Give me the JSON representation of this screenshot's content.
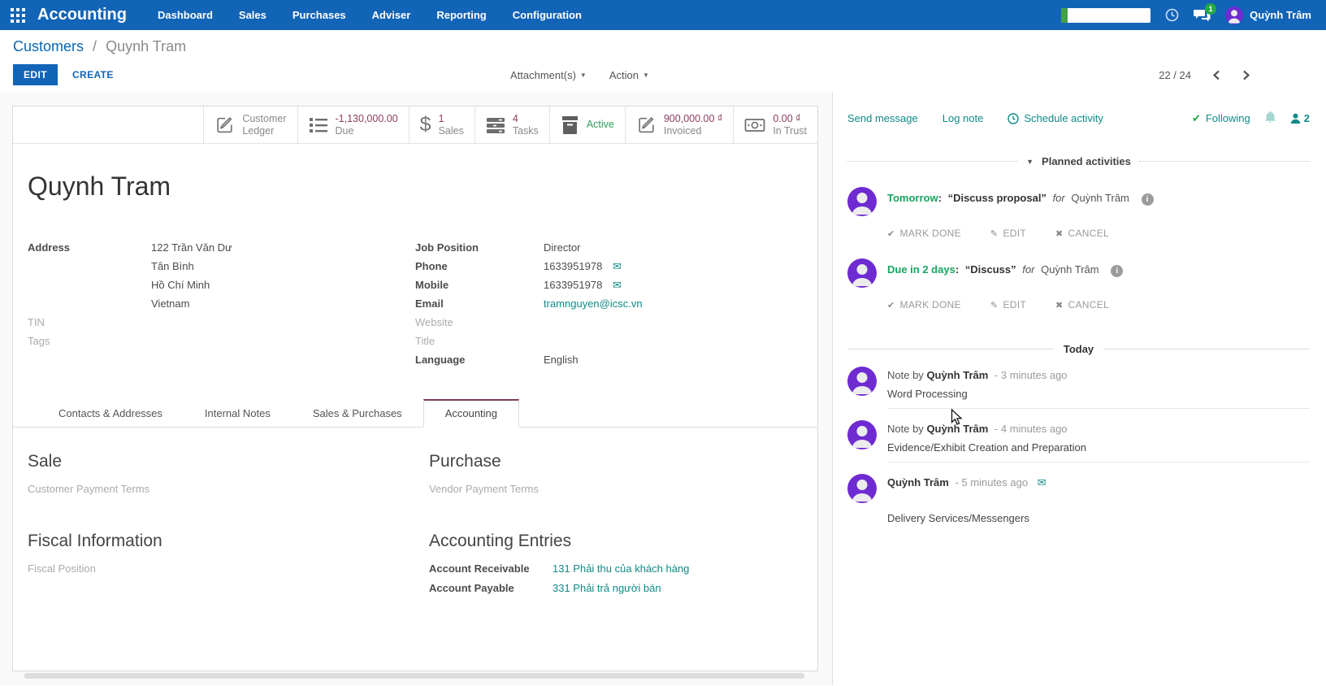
{
  "colors": {
    "navbar_blue": "#1264b7",
    "breadcrumb_link_blue": "#0c66ad",
    "teal_link": "#0f8a87",
    "stat_value_maroon": "#8b3d60",
    "active_green": "#2e9e5b",
    "due_green": "#18a45f",
    "avatar_purple": "#6f2bd2",
    "badge_green": "#28a745"
  },
  "navbar": {
    "app_name": "Accounting",
    "menu": [
      {
        "label": "Dashboard"
      },
      {
        "label": "Sales"
      },
      {
        "label": "Purchases"
      },
      {
        "label": "Adviser"
      },
      {
        "label": "Reporting"
      },
      {
        "label": "Configuration"
      }
    ],
    "messages_badge": "1",
    "user_name": "Quỳnh Trâm"
  },
  "control_panel": {
    "breadcrumb_parent": "Customers",
    "breadcrumb_separator": "/",
    "breadcrumb_current": "Quynh Tram",
    "edit_button": "EDIT",
    "create_button": "CREATE",
    "attachments_dropdown": "Attachment(s)",
    "action_dropdown": "Action",
    "pager": "22 / 24"
  },
  "stats": [
    {
      "line1": "Customer",
      "line2": "Ledger"
    },
    {
      "value": "-1,130,000.00",
      "label": "Due"
    },
    {
      "value": "1",
      "label": "Sales"
    },
    {
      "value": "4",
      "label": "Tasks"
    },
    {
      "value": "Active"
    },
    {
      "value": "900,000.00 ₫",
      "label": "Invoiced"
    },
    {
      "value": "0.00 ₫",
      "label": "In Trust"
    }
  ],
  "form": {
    "title": "Quynh Tram",
    "address_label": "Address",
    "address_line1": "122 Trần Văn Dư",
    "address_line2": "Tân Bình",
    "address_line3": "Hồ Chí Minh",
    "address_line4": "Vietnam",
    "tin_label": "TIN",
    "tags_label": "Tags",
    "job_label": "Job Position",
    "job_value": "Director",
    "phone_label": "Phone",
    "phone_value": "1633951978",
    "mobile_label": "Mobile",
    "mobile_value": "1633951978",
    "email_label": "Email",
    "email_value": "tramnguyen@icsc.vn",
    "website_label": "Website",
    "title_label": "Title",
    "language_label": "Language",
    "language_value": "English"
  },
  "tabs": [
    {
      "label": "Contacts & Addresses"
    },
    {
      "label": "Internal Notes"
    },
    {
      "label": "Sales & Purchases"
    },
    {
      "label": "Accounting"
    }
  ],
  "accounting_tab": {
    "sale_heading": "Sale",
    "customer_payment_terms_label": "Customer Payment Terms",
    "purchase_heading": "Purchase",
    "vendor_payment_terms_label": "Vendor Payment Terms",
    "fiscal_heading": "Fiscal Information",
    "fiscal_position_label": "Fiscal Position",
    "entries_heading": "Accounting Entries",
    "receivable_label": "Account Receivable",
    "receivable_value": "131 Phải thu của khách hàng",
    "payable_label": "Account Payable",
    "payable_value": "331 Phải trả người bán"
  },
  "chatter": {
    "send_message": "Send message",
    "log_note": "Log note",
    "schedule_activity": "Schedule activity",
    "following": "Following",
    "followers_count": "2",
    "planned_header": "Planned activities",
    "today_header": "Today",
    "activities": [
      {
        "due": "Tomorrow",
        "colon": ":",
        "summary": "“Discuss proposal”",
        "for_word": "for",
        "assignee": "Quỳnh Trâm",
        "mark_done": "MARK DONE",
        "edit": "EDIT",
        "cancel": "CANCEL"
      },
      {
        "due": "Due in 2 days",
        "colon": ":",
        "summary": "“Discuss”",
        "for_word": "for",
        "assignee": "Quỳnh Trâm",
        "mark_done": "MARK DONE",
        "edit": "EDIT",
        "cancel": "CANCEL"
      }
    ],
    "messages": [
      {
        "prefix": "Note by",
        "author": "Quỳnh Trâm",
        "time": "- 3 minutes ago",
        "body": "Word Processing"
      },
      {
        "prefix": "Note by",
        "author": "Quỳnh Trâm",
        "time": "- 4 minutes ago",
        "body": "Evidence/Exhibit Creation and Preparation"
      },
      {
        "prefix": "",
        "author": "Quỳnh Trâm",
        "time": "- 5 minutes ago",
        "body": "Delivery Services/Messengers"
      }
    ]
  }
}
